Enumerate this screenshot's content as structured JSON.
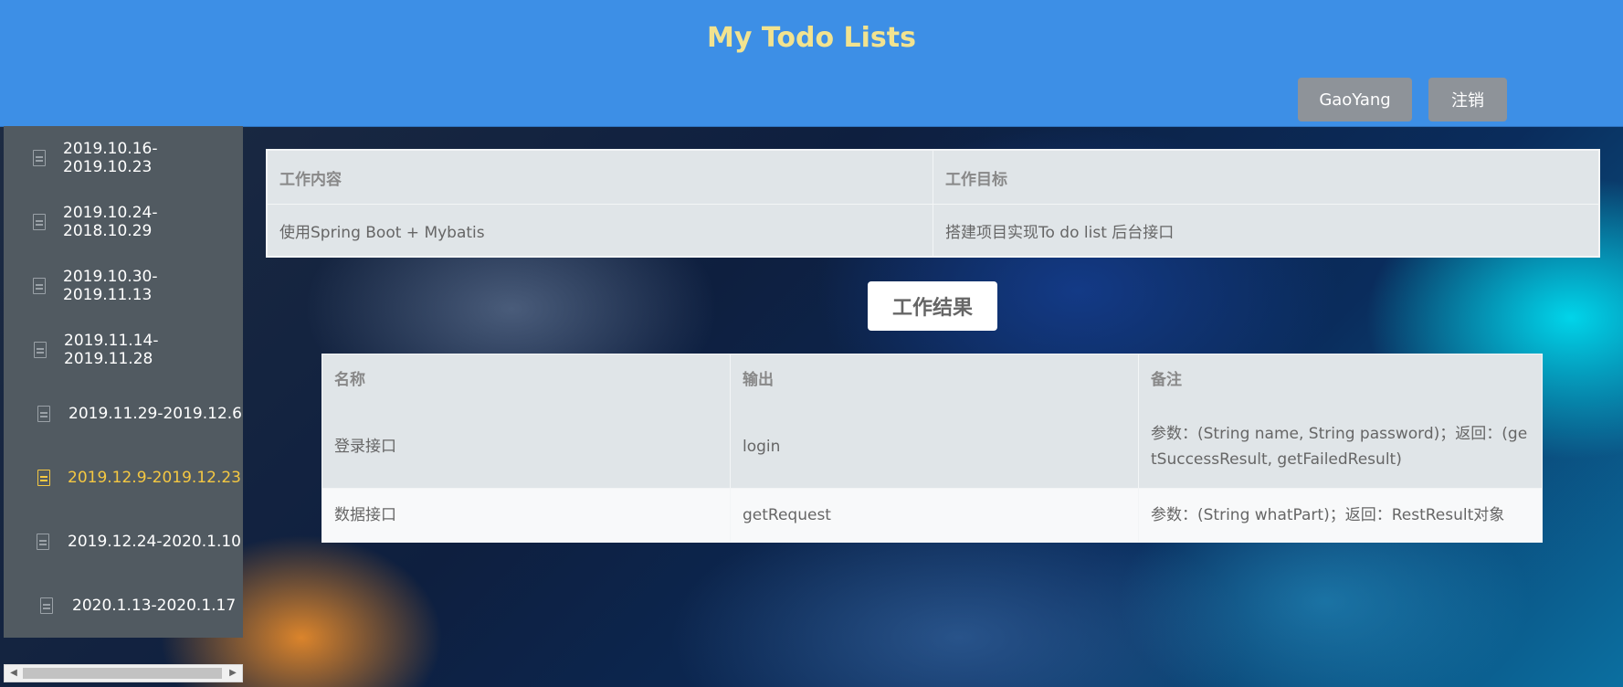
{
  "header": {
    "title": "My Todo Lists",
    "user_button": "GaoYang",
    "logout_button": "注销",
    "bg_color": "#3d8fe6",
    "title_color": "#f2e38f"
  },
  "sidebar": {
    "items": [
      {
        "label": "2019.10.16-2019.10.23",
        "icon": "document-icon",
        "active": false
      },
      {
        "label": "2019.10.24-2018.10.29",
        "icon": "document-icon",
        "active": false
      },
      {
        "label": "2019.10.30-2019.11.13",
        "icon": "document-icon",
        "active": false
      },
      {
        "label": "2019.11.14-2019.11.28",
        "icon": "document-icon",
        "active": false
      },
      {
        "label": "2019.11.29-2019.12.6",
        "icon": "document-icon",
        "active": false
      },
      {
        "label": "2019.12.9-2019.12.23",
        "icon": "document-icon",
        "active": true
      },
      {
        "label": "2019.12.24-2020.1.10",
        "icon": "document-icon",
        "active": false
      },
      {
        "label": "2020.1.13-2020.1.17",
        "icon": "document-icon",
        "active": false
      }
    ],
    "active_color": "#f5c842"
  },
  "work_table": {
    "headers": [
      "工作内容",
      "工作目标"
    ],
    "rows": [
      [
        "使用Spring Boot + Mybatis",
        "搭建项目实现To do list 后台接口"
      ]
    ]
  },
  "result_button": "工作结果",
  "result_table": {
    "headers": [
      "名称",
      "输出",
      "备注"
    ],
    "rows": [
      [
        "登录接口",
        "login",
        "参数：(String name, String password)；返回：(getSuccessResult, getFailedResult)"
      ],
      [
        "数据接口",
        "getRequest",
        "参数：(String whatPart)；返回：RestResult对象"
      ]
    ]
  }
}
